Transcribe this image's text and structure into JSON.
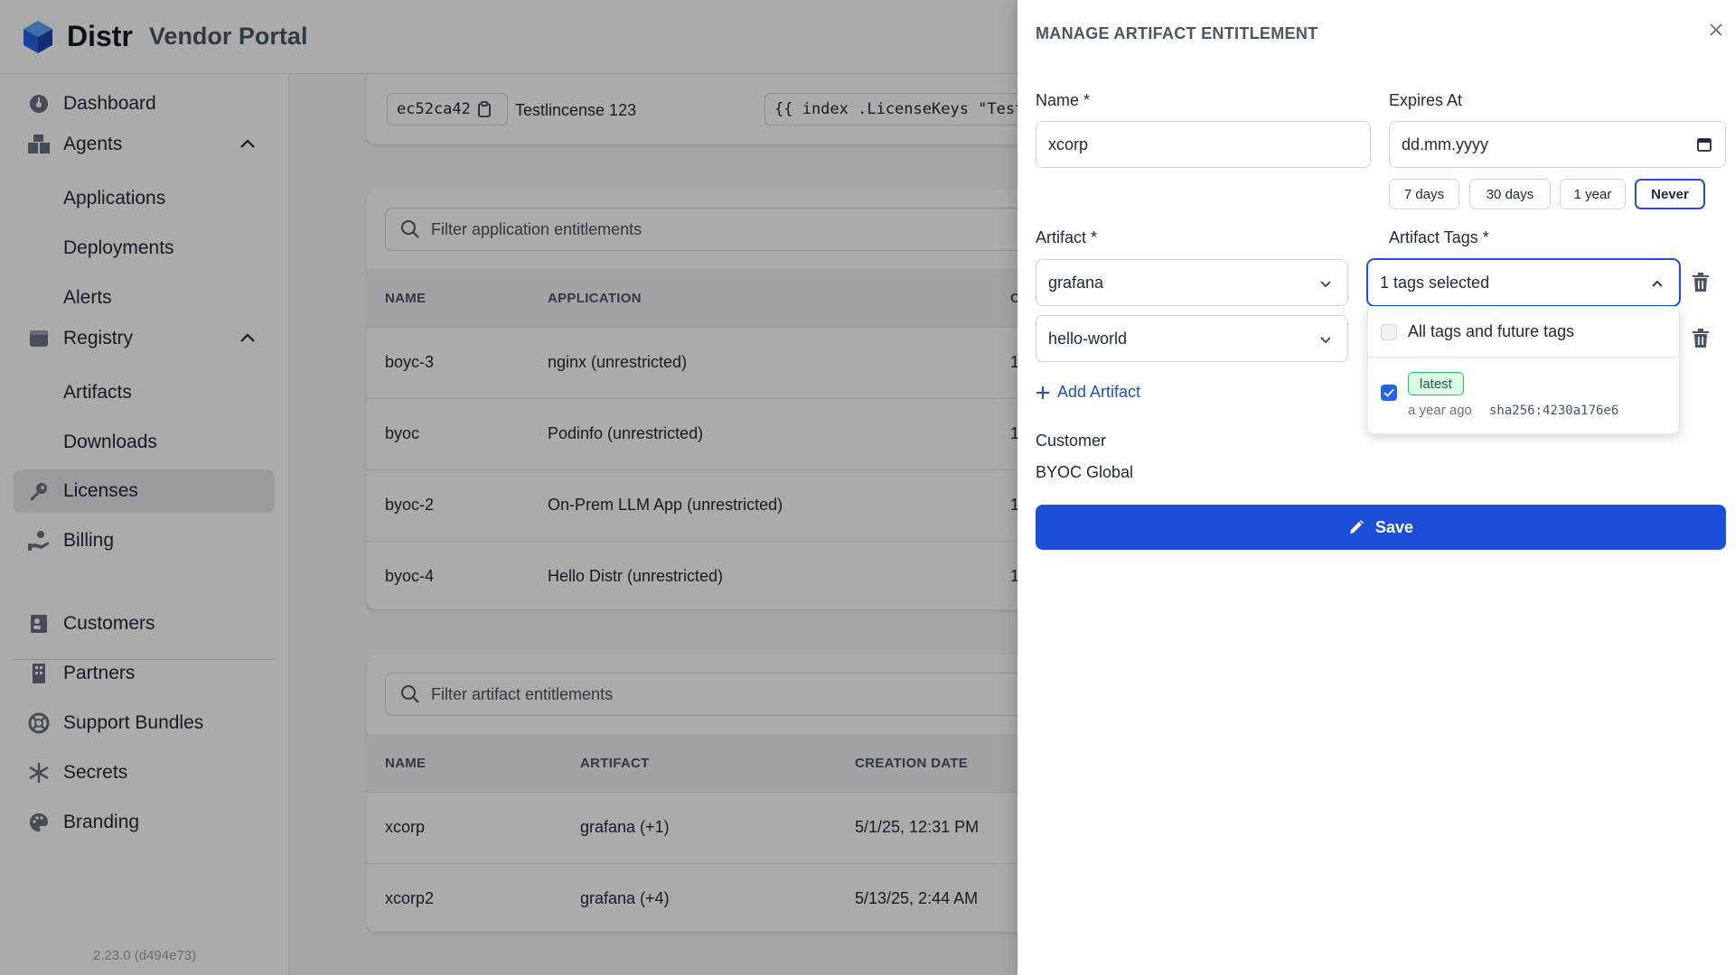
{
  "brand": {
    "name": "Distr",
    "subtitle": "Vendor Portal"
  },
  "sidebar": {
    "items": [
      {
        "label": "Dashboard",
        "icon": "dashboard-icon"
      },
      {
        "label": "Agents",
        "icon": "agents-icon",
        "expanded": true
      },
      {
        "label": "Applications"
      },
      {
        "label": "Deployments"
      },
      {
        "label": "Alerts"
      },
      {
        "label": "Registry",
        "icon": "registry-icon",
        "expanded": true
      },
      {
        "label": "Artifacts"
      },
      {
        "label": "Downloads"
      },
      {
        "label": "Licenses",
        "icon": "key-icon",
        "active": true
      },
      {
        "label": "Billing",
        "icon": "billing-icon"
      },
      {
        "label": "Customers",
        "icon": "customers-icon"
      },
      {
        "label": "Partners",
        "icon": "partners-icon"
      },
      {
        "label": "Support Bundles",
        "icon": "lifebuoy-icon"
      },
      {
        "label": "Secrets",
        "icon": "asterisk-icon"
      },
      {
        "label": "Branding",
        "icon": "palette-icon"
      }
    ],
    "version": "2.23.0 (d494e73)"
  },
  "license_header": {
    "license_id": "ec52ca42",
    "license_name": "Testlincense 123",
    "template_snippet": "{{ index .LicenseKeys \"Testlincense"
  },
  "app_entitlements": {
    "filter_placeholder": "Filter application entitlements",
    "columns": [
      "NAME",
      "APPLICATION",
      "C"
    ],
    "rows": [
      {
        "name": "boyc-3",
        "application": "nginx (unrestricted)",
        "extra": "1"
      },
      {
        "name": "byoc",
        "application": "Podinfo (unrestricted)",
        "extra": "1"
      },
      {
        "name": "byoc-2",
        "application": "On-Prem LLM App (unrestricted)",
        "extra": "1"
      },
      {
        "name": "byoc-4",
        "application": "Hello Distr (unrestricted)",
        "extra": "1"
      }
    ]
  },
  "artifact_entitlements": {
    "filter_placeholder": "Filter artifact entitlements",
    "columns": [
      "NAME",
      "ARTIFACT",
      "CREATION DATE"
    ],
    "rows": [
      {
        "name": "xcorp",
        "artifact": "grafana (+1)",
        "created": "5/1/25, 12:31 PM"
      },
      {
        "name": "xcorp2",
        "artifact": "grafana (+4)",
        "created": "5/13/25, 2:44 AM"
      }
    ]
  },
  "drawer": {
    "title": "MANAGE ARTIFACT ENTITLEMENT",
    "name_label": "Name *",
    "name_value": "xcorp",
    "expires_label": "Expires At",
    "expires_placeholder": "dd.mm.yyyy",
    "expiry_presets": [
      "7 days",
      "30 days",
      "1 year",
      "Never"
    ],
    "expiry_selected": "Never",
    "artifact_label": "Artifact *",
    "artifacts": [
      "grafana",
      "hello-world"
    ],
    "artifact_tags_label": "Artifact Tags *",
    "tags_summary": "1 tags selected",
    "tags_dropdown": {
      "all_tags_label": "All tags and future tags",
      "all_tags_checked": false,
      "tag": {
        "name": "latest",
        "time": "a year ago",
        "digest": "sha256:4230a176e6",
        "checked": true
      }
    },
    "add_artifact_label": "Add Artifact",
    "customer_label": "Customer",
    "customer_value": "BYOC Global",
    "save_label": "Save"
  },
  "colors": {
    "primary": "#1d4ed8",
    "tag_green": "#22c55e"
  }
}
